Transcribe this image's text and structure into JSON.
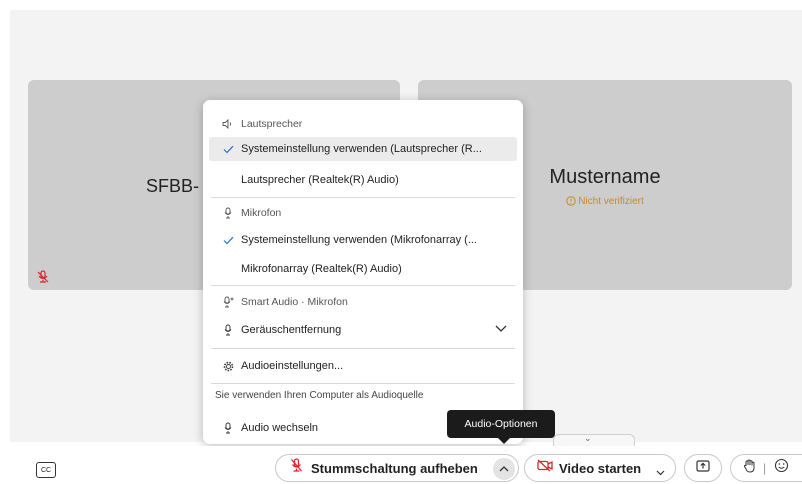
{
  "participants": {
    "left_name": "SFBB-",
    "right_name": "Mustername",
    "right_status": "Nicht verifiziert"
  },
  "audio_menu": {
    "speaker_header": "Lautsprecher",
    "speaker_options": [
      "Systemeinstellung verwenden (Lautsprecher (R...",
      "Lautsprecher (Realtek(R) Audio)"
    ],
    "mic_header": "Mikrofon",
    "mic_options": [
      "Systemeinstellung verwenden (Mikrofonarray (...",
      "Mikrofonarray (Realtek(R) Audio)"
    ],
    "smart_header": "Smart Audio · Mikrofon",
    "noise_label": "Geräuschentfernung",
    "settings_label": "Audioeinstellungen...",
    "source_note": "Sie verwenden Ihren Computer als Audioquelle",
    "switch_label": "Audio wechseln"
  },
  "tooltip": "Audio-Optionen",
  "toolbar": {
    "cc_label": "CC",
    "mute_label": "Stummschaltung aufheben",
    "video_label": "Video starten"
  },
  "colors": {
    "mute_red": "#d9262c",
    "verify_orange": "#c7892a"
  }
}
